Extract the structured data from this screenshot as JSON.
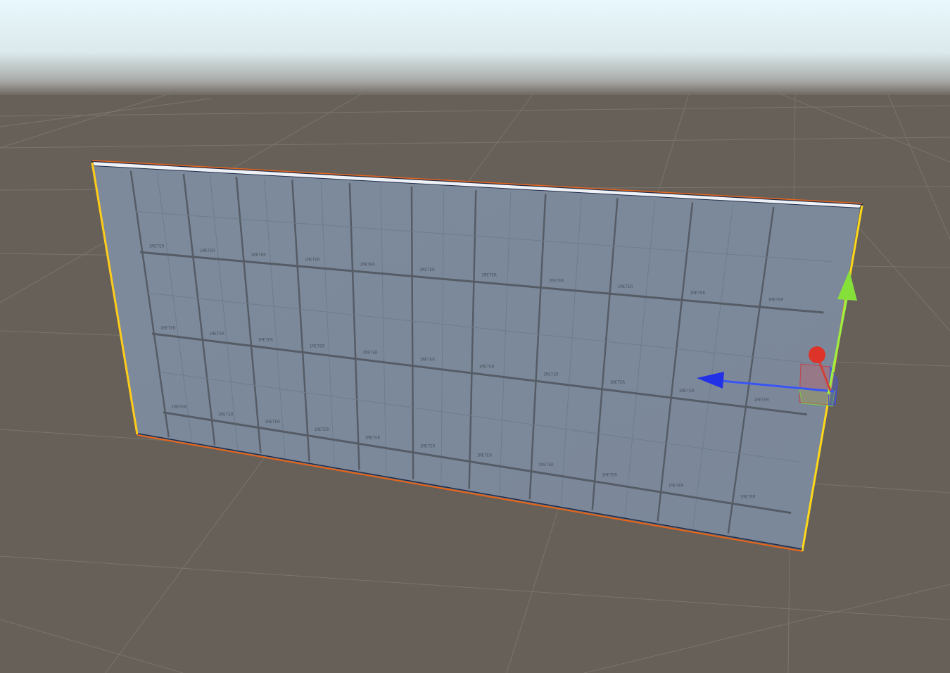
{
  "scene": {
    "object": "wall",
    "texture_label": "1METER"
  },
  "gizmo": {
    "type": "move",
    "axes": [
      "x",
      "y",
      "z"
    ]
  },
  "colors": {
    "sky_top": "#e6f6fb",
    "horizon": "#b9bcbd",
    "floor": "#676059",
    "floor_grid": "#7a746d",
    "wall_face": "#7a8899",
    "wall_grid": "#555c66",
    "selection_outline": "#ffb400",
    "x_axis": "#e0352b",
    "y_axis": "#8ee63a",
    "z_axis": "#2b46f0"
  }
}
